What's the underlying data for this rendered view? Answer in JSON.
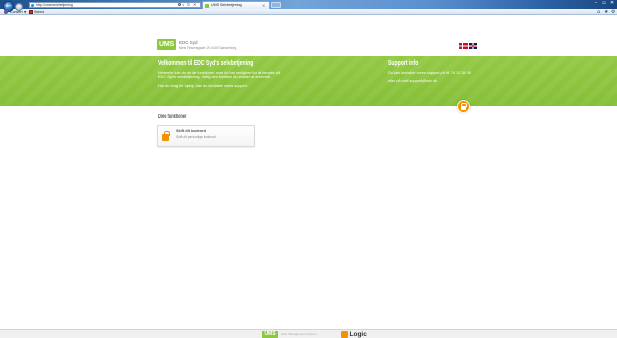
{
  "browser": {
    "address_url": "http://ums/selvbetjening",
    "tab_title": "UMS Selvbetjening",
    "toolbar": {
      "convert_label": "Convert",
      "select_label": "Select"
    }
  },
  "header": {
    "logo_text": "UMS",
    "org_name": "EDC Syd",
    "org_address": "Niels Finsensgade 19, 6400 Sønderborg"
  },
  "banner": {
    "title": "Velkommen til EDC Syd's selvbetjening",
    "body_lines": [
      "Nedenfor kan du se de funktioner, som du har mulighed for at benytte på",
      "EDC Syd's selvbetjening. Vælg den funktion du ønsker at anvende.",
      "Har du brug for hjælp, kan du kontakte vores support."
    ],
    "support": {
      "title": "Support info",
      "lines": [
        "Du kan kontakte vores support på tlf. 74 12 34 00",
        "eller på mail support@edc.dk"
      ]
    }
  },
  "functions": {
    "title": "Dine funktioner",
    "items": [
      {
        "title": "Skift dit kodeord",
        "description": "Skift dit personlige kodeord",
        "icon": "lock-icon"
      }
    ]
  },
  "footer": {
    "ums_logo": "UMS",
    "tagline": "User Management System",
    "logic_logo_text": "Logic"
  },
  "icons": {
    "browser": [
      "back-icon",
      "forward-icon",
      "search-icon",
      "refresh-icon",
      "stop-icon",
      "home-icon",
      "favorites-icon",
      "tools-icon"
    ],
    "languages": [
      "flag-dk-icon",
      "flag-uk-icon"
    ],
    "banner_badge": "user-icon"
  },
  "colors": {
    "brand_green": "#8dc63f",
    "accent_orange": "#f39200",
    "browser_blue": "#2f67ac"
  }
}
